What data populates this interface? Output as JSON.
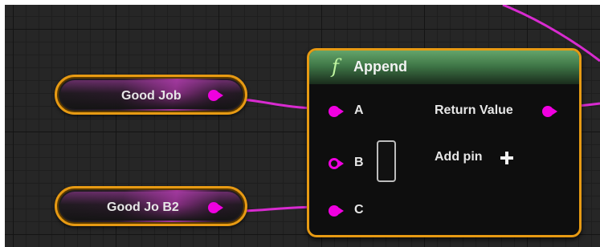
{
  "variables": [
    {
      "label": "Good Job"
    },
    {
      "label": "Good Jo B2"
    }
  ],
  "append_node": {
    "icon": "f",
    "title": "Append",
    "inputs": [
      {
        "label": "A",
        "connected": true
      },
      {
        "label": "B",
        "connected": false
      },
      {
        "label": "C",
        "connected": true
      }
    ],
    "output_label": "Return Value",
    "add_pin_label": "Add pin"
  },
  "colors": {
    "string_pin": "#f000e0",
    "node_border": "#e79a13",
    "function_header": "#3f7747",
    "grid_background": "#262626"
  }
}
